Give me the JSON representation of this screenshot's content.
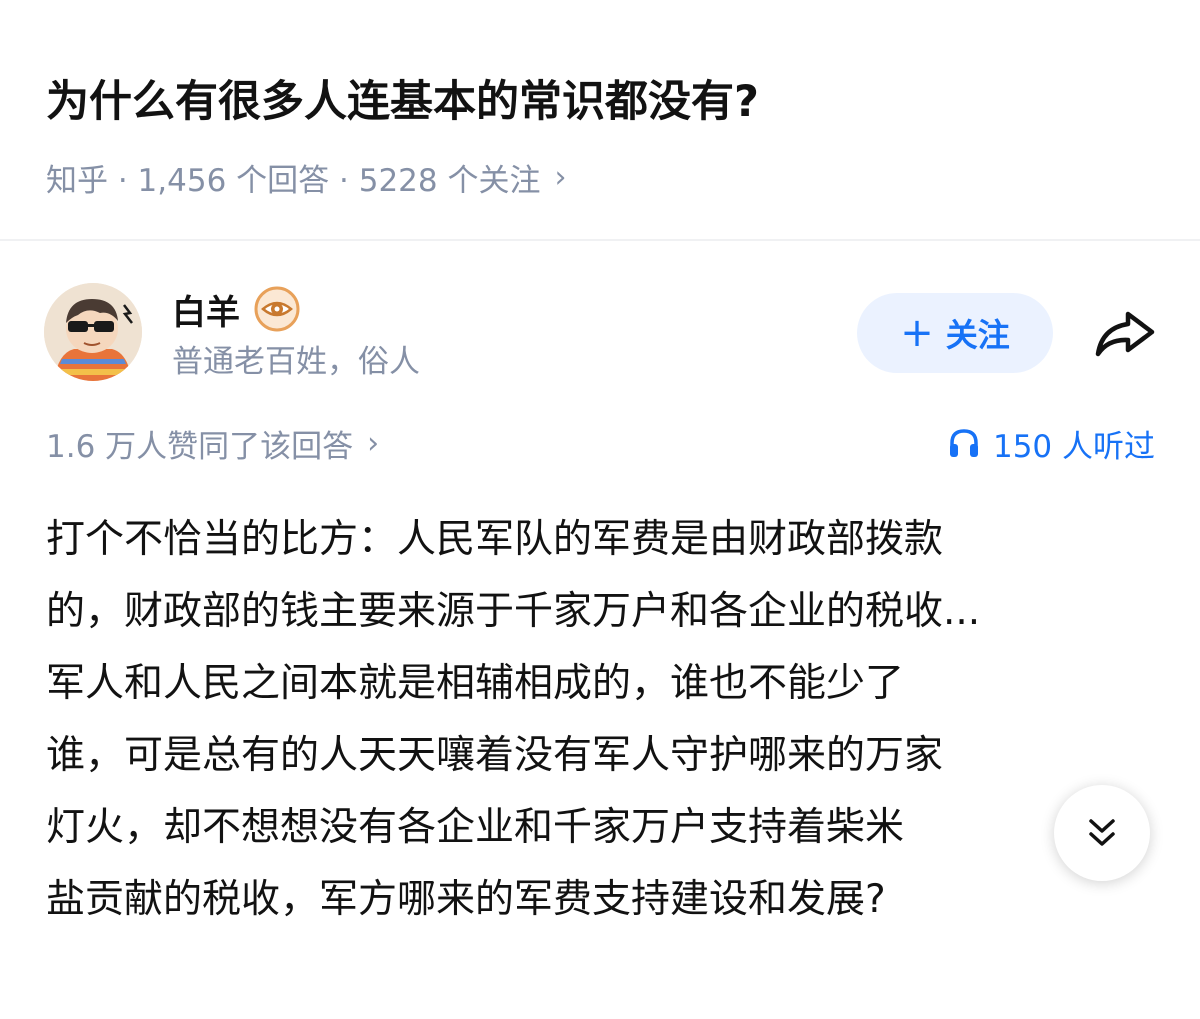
{
  "question": {
    "title": "为什么有很多人连基本的常识都没有?",
    "meta": "知乎 · 1,456 个回答 · 5228 个关注",
    "meta_chevron": "›"
  },
  "author": {
    "name": "白羊",
    "bio": "普通老百姓，俗人",
    "badge_icon": "eye-badge-icon",
    "avatar_icon": "avatar-cartoon"
  },
  "actions": {
    "follow_plus": "+",
    "follow_label": "关注",
    "share_icon": "share-arrow-icon"
  },
  "stats": {
    "votes_label": "1.6 万人赞同了该回答",
    "votes_chevron": "›",
    "listen_label": "150 人听过",
    "listen_icon": "headphones-icon"
  },
  "answer": {
    "lines": [
      "打个不恰当的比方：人民军队的军费是由财政部拨款",
      "的，财政部的钱主要来源于千家万户和各企业的税收...",
      "军人和人民之间本就是相辅相成的，谁也不能少了",
      "谁，可是总有的人天天嚷着没有军人守护哪来的万家",
      "灯火，却不想想没有各企业和千家万户支持着柴米",
      "盐贡献的税收，军方哪来的军费支持建设和发展?"
    ]
  },
  "colors": {
    "accent": "#1772f6",
    "accent_bg": "#ebf2ff",
    "meta_gray": "#8590a6",
    "text": "#121212",
    "badge": "#e8a15a"
  }
}
